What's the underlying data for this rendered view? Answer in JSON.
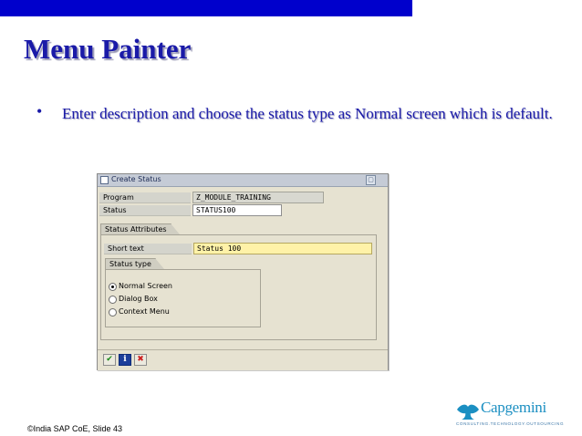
{
  "slide": {
    "title": "Menu Painter",
    "bullet": "Enter description and choose the status type as Normal screen which is default.",
    "footer": "©India SAP CoE, Slide 43"
  },
  "colors": {
    "topbar": "#0000cc",
    "title": "#1a1aa8",
    "dialog_bg": "#e6e2d1",
    "short_text_field": "#fff2a8",
    "logo": "#1b8fc2"
  },
  "dialog": {
    "title": "Create Status",
    "fields": [
      {
        "label": "Program",
        "value": "Z_MODULE_TRAINING"
      },
      {
        "label": "Status",
        "value": "STATUS100"
      }
    ],
    "attributes": {
      "group_title": "Status Attributes",
      "short_text_label": "Short text",
      "short_text_value": "Status 100"
    },
    "status_type": {
      "group_title": "Status type",
      "options": [
        {
          "label": "Normal Screen",
          "selected": true
        },
        {
          "label": "Dialog Box",
          "selected": false
        },
        {
          "label": "Context Menu",
          "selected": false
        }
      ]
    },
    "buttons": [
      {
        "name": "confirm",
        "icon": "checkmark-icon",
        "glyph": "✔"
      },
      {
        "name": "info",
        "icon": "info-icon",
        "glyph": "i"
      },
      {
        "name": "cancel",
        "icon": "cancel-icon",
        "glyph": "✖"
      }
    ]
  },
  "logo": {
    "name": "Capgemini",
    "tagline": "CONSULTING.TECHNOLOGY.OUTSOURCING"
  }
}
